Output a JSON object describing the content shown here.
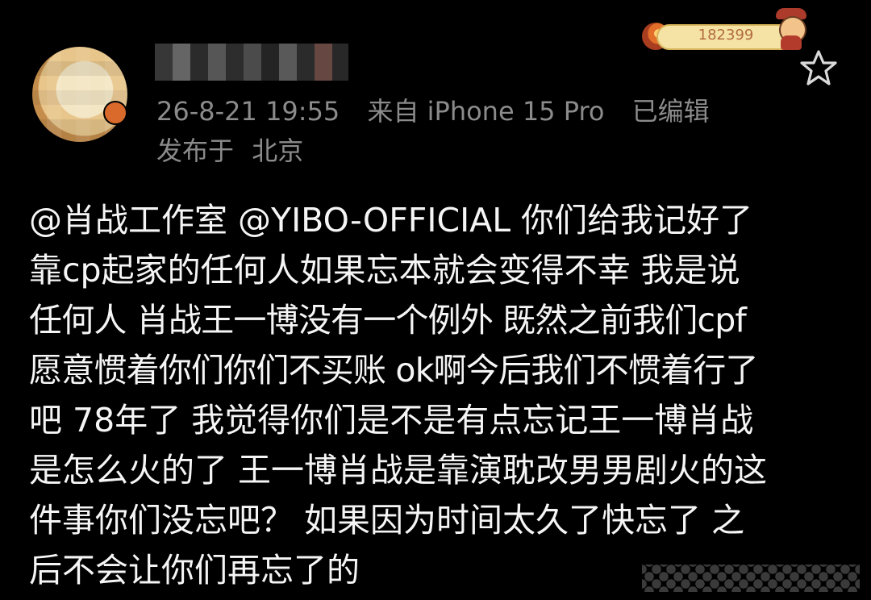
{
  "post": {
    "meta": {
      "timestamp": "26-8-21 19:55",
      "source": "来自 iPhone 15 Pro",
      "edited": "已编辑"
    },
    "location": {
      "label": "发布于",
      "value": "北京"
    },
    "fan_badge": {
      "number": "182399"
    },
    "content": {
      "lines": [
        "@肖战工作室 @YIBO-OFFICIAL  你们给我记好了",
        "靠cp起家的任何人如果忘本就会变得不幸 我是说",
        "任何人 肖战王一博没有一个例外 既然之前我们cpf",
        "愿意惯着你们你们不买账 ok啊今后我们不惯着行了",
        "吧  78年了 我觉得你们是不是有点忘记王一博肖战",
        "是怎么火的了 王一博肖战是靠演耽改男男剧火的这",
        "件事你们没忘吧？ 如果因为时间太久了快忘了 之",
        "后不会让你们再忘了的"
      ]
    },
    "icons": {
      "avatar": "avatar-icon",
      "star": "star-icon",
      "fan_badge": "fan-badge-icon"
    }
  }
}
